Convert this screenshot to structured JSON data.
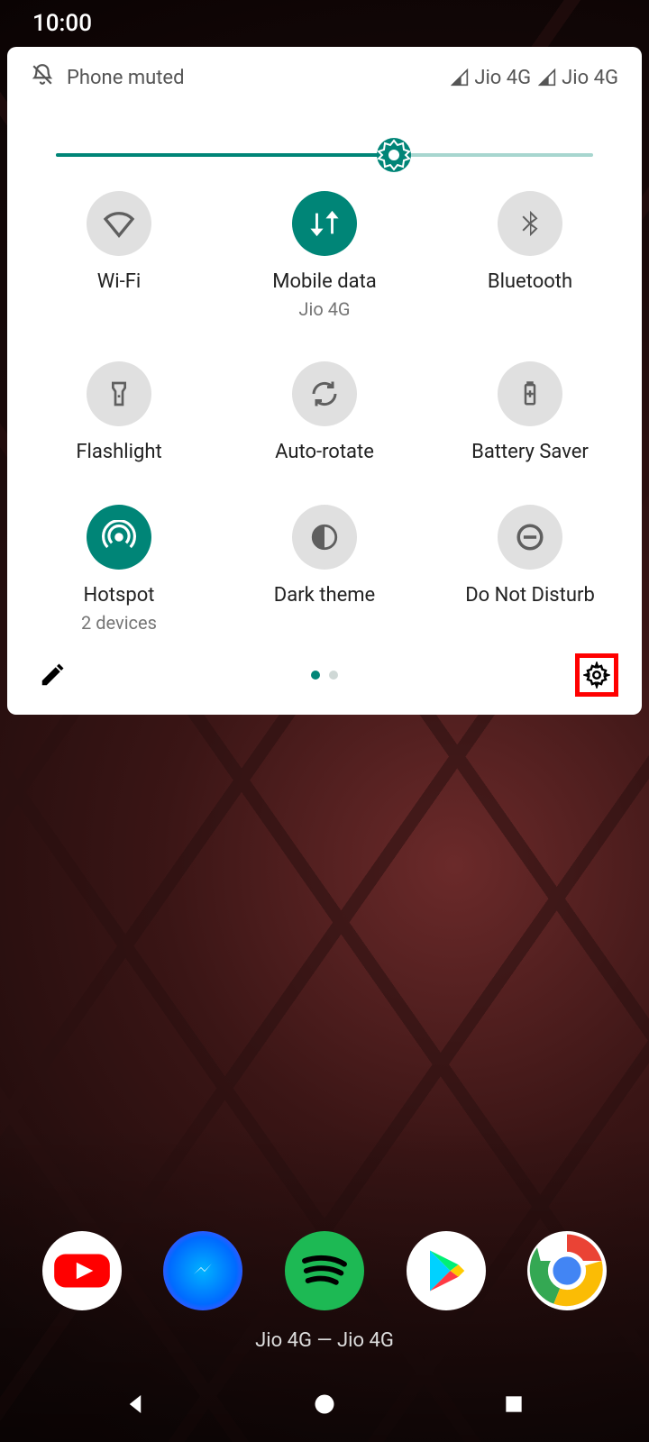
{
  "status": {
    "time": "10:00"
  },
  "header": {
    "muted_label": "Phone muted",
    "signal1": "Jio 4G",
    "signal2": "Jio 4G"
  },
  "brightness": {
    "percent": 63
  },
  "tiles": [
    {
      "id": "wifi",
      "label": "Wi-Fi",
      "sub": "",
      "active": false
    },
    {
      "id": "mobile-data",
      "label": "Mobile data",
      "sub": "Jio 4G",
      "active": true
    },
    {
      "id": "bluetooth",
      "label": "Bluetooth",
      "sub": "",
      "active": false
    },
    {
      "id": "flashlight",
      "label": "Flashlight",
      "sub": "",
      "active": false
    },
    {
      "id": "auto-rotate",
      "label": "Auto-rotate",
      "sub": "",
      "active": false
    },
    {
      "id": "battery-saver",
      "label": "Battery Saver",
      "sub": "",
      "active": false
    },
    {
      "id": "hotspot",
      "label": "Hotspot",
      "sub": "2 devices",
      "active": true
    },
    {
      "id": "dark-theme",
      "label": "Dark theme",
      "sub": "",
      "active": false
    },
    {
      "id": "dnd",
      "label": "Do Not Disturb",
      "sub": "",
      "active": false
    }
  ],
  "footer": {
    "page_index": 0,
    "page_count": 2
  },
  "carrier_line": "Jio 4G — Jio 4G",
  "dock": [
    {
      "id": "youtube"
    },
    {
      "id": "messenger"
    },
    {
      "id": "spotify"
    },
    {
      "id": "play-store"
    },
    {
      "id": "chrome"
    }
  ],
  "colors": {
    "accent": "#008577",
    "highlight": "#ff0000"
  }
}
